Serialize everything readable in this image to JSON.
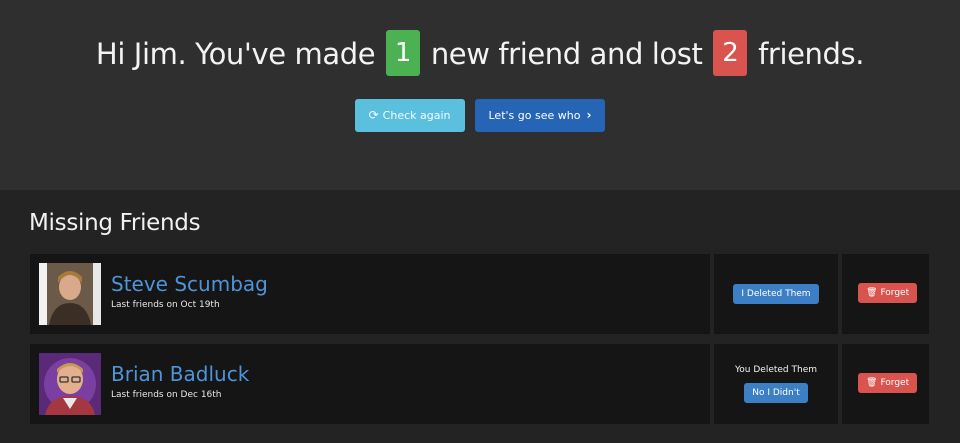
{
  "summary": {
    "greeting": "Hi Jim. You've made",
    "new_count": "1",
    "middle": "new friend and lost",
    "lost_count": "2",
    "end": "friends.",
    "badge_colors": {
      "new": "#4bb153",
      "lost": "#d9534f"
    }
  },
  "actions": {
    "check_again_label": "Check again",
    "check_again_icon": "refresh-icon",
    "go_see_label": "Let's go see who",
    "go_see_icon": "chevron-right-icon"
  },
  "missing": {
    "title": "Missing Friends",
    "rows": [
      {
        "name": "Steve Scumbag",
        "since": "Last friends on Oct 19th",
        "status_label": "",
        "status_button": "I Deleted Them",
        "forget_label": "Forget",
        "forget_icon": "trash-icon"
      },
      {
        "name": "Brian Badluck",
        "since": "Last friends on Dec 16th",
        "status_label": "You Deleted Them",
        "status_button": "No I Didn't",
        "forget_label": "Forget",
        "forget_icon": "trash-icon"
      }
    ]
  }
}
